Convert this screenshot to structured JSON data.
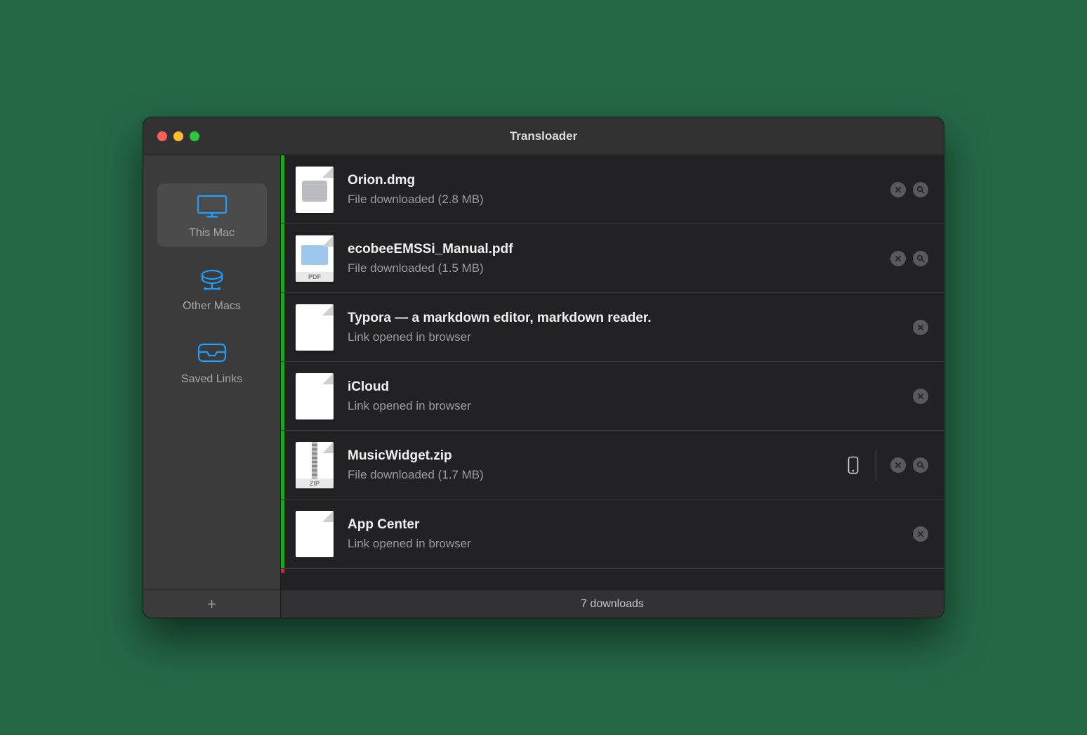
{
  "window": {
    "title": "Transloader"
  },
  "sidebar": {
    "items": [
      {
        "label": "This Mac",
        "icon": "desktop-icon",
        "active": true
      },
      {
        "label": "Other Macs",
        "icon": "network-drive-icon",
        "active": false
      },
      {
        "label": "Saved Links",
        "icon": "inbox-icon",
        "active": false
      }
    ]
  },
  "list": [
    {
      "title": "Orion.dmg",
      "subtitle": "File downloaded (2.8 MB)",
      "thumb": "dmg",
      "tag": "",
      "accent": "green",
      "actions": [
        "close",
        "reveal"
      ]
    },
    {
      "title": "ecobeeEMSSi_Manual.pdf",
      "subtitle": "File downloaded (1.5 MB)",
      "thumb": "pdf",
      "tag": "PDF",
      "accent": "green",
      "actions": [
        "close",
        "reveal"
      ]
    },
    {
      "title": "Typora — a markdown editor, markdown reader.",
      "subtitle": "Link opened in browser",
      "thumb": "blank",
      "tag": "",
      "accent": "green",
      "actions": [
        "close"
      ]
    },
    {
      "title": "iCloud",
      "subtitle": "Link opened in browser",
      "thumb": "blank",
      "tag": "",
      "accent": "green",
      "actions": [
        "close"
      ]
    },
    {
      "title": "MusicWidget.zip",
      "subtitle": "File downloaded (1.7 MB)",
      "thumb": "zip",
      "tag": "ZIP",
      "accent": "green",
      "actions": [
        "device",
        "sep",
        "close",
        "reveal"
      ]
    },
    {
      "title": "App Center",
      "subtitle": "Link opened in browser",
      "thumb": "blank",
      "tag": "",
      "accent": "green",
      "actions": [
        "close"
      ]
    }
  ],
  "partialAccent": "red",
  "footer": {
    "status": "7 downloads",
    "addTooltip": "Add"
  }
}
